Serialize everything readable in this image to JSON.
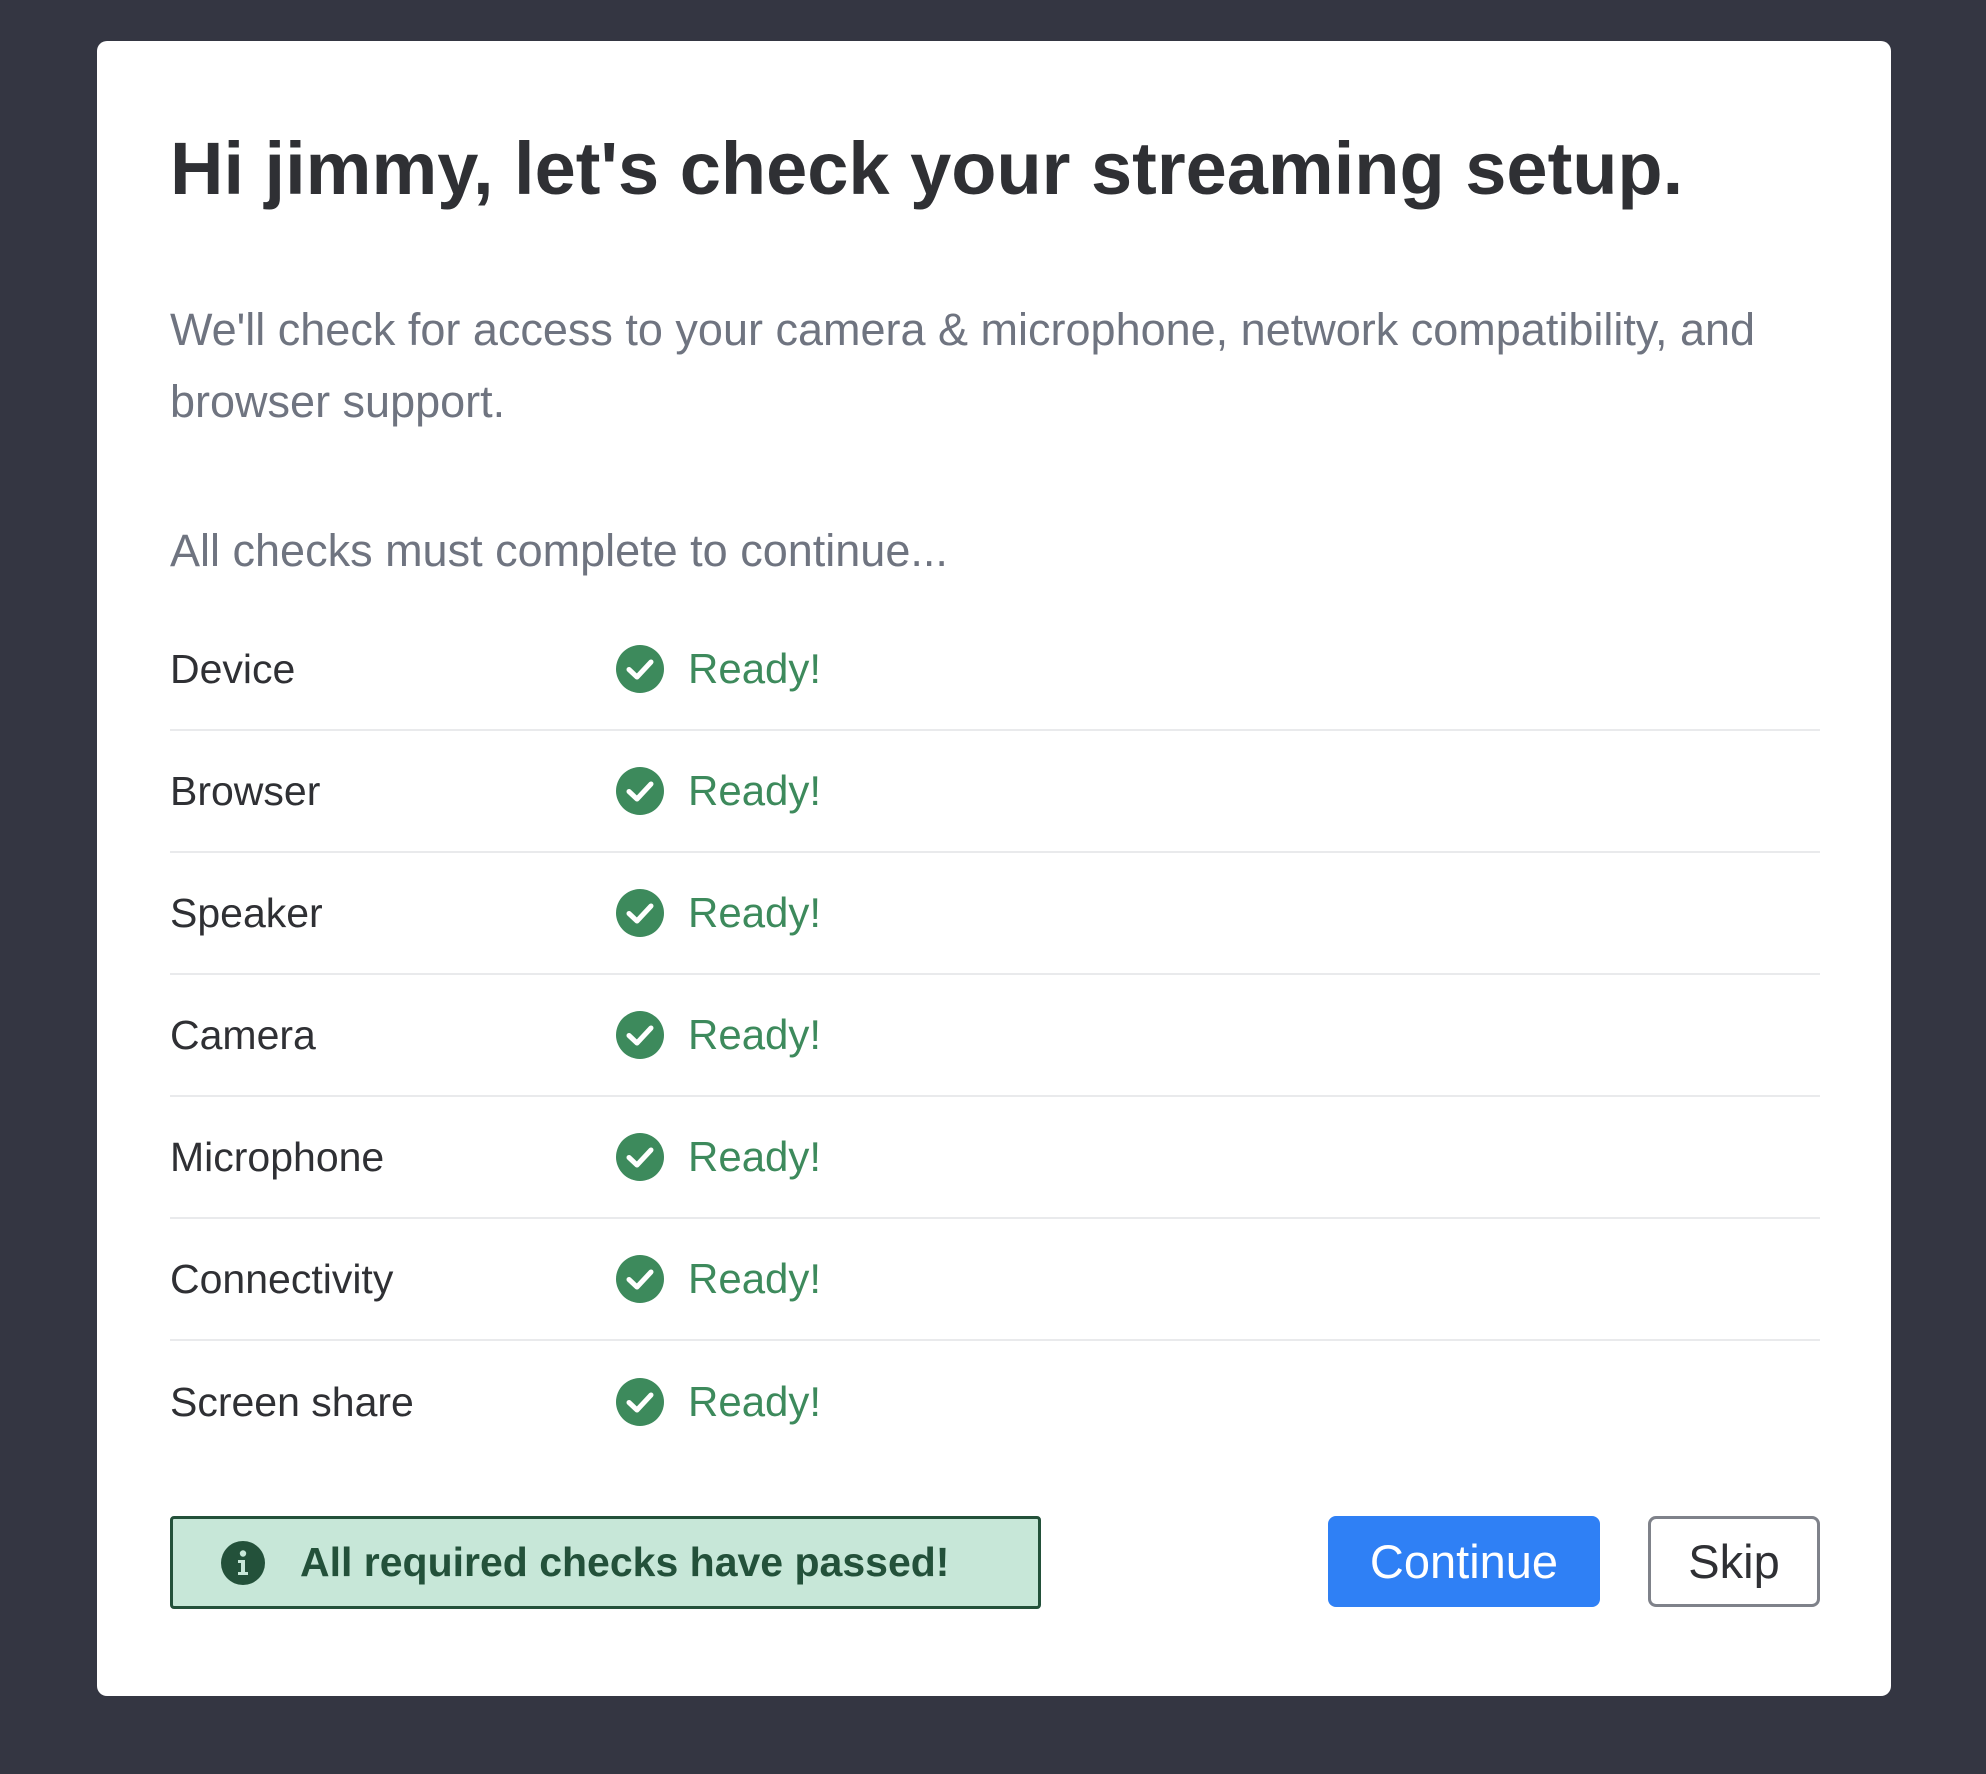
{
  "dialog": {
    "title": "Hi jimmy, let's check your streaming setup.",
    "description": "We'll check for access to your camera & microphone, network compatibility, and browser support.",
    "note": "All checks must complete to continue..."
  },
  "checks": [
    {
      "name": "Device",
      "status": "Ready!",
      "icon": "check-circle-icon"
    },
    {
      "name": "Browser",
      "status": "Ready!",
      "icon": "check-circle-icon"
    },
    {
      "name": "Speaker",
      "status": "Ready!",
      "icon": "check-circle-icon"
    },
    {
      "name": "Camera",
      "status": "Ready!",
      "icon": "check-circle-icon"
    },
    {
      "name": "Microphone",
      "status": "Ready!",
      "icon": "check-circle-icon"
    },
    {
      "name": "Connectivity",
      "status": "Ready!",
      "icon": "check-circle-icon"
    },
    {
      "name": "Screen share",
      "status": "Ready!",
      "icon": "check-circle-icon"
    }
  ],
  "banner": {
    "icon": "info-icon",
    "text": "All required checks have passed!"
  },
  "actions": {
    "continue_label": "Continue",
    "skip_label": "Skip"
  },
  "colors": {
    "backdrop": "#343642",
    "success": "#3d8a5c",
    "banner_background": "#c7e7d8",
    "banner_text": "#23513a",
    "primary_button": "#2f80f5"
  }
}
